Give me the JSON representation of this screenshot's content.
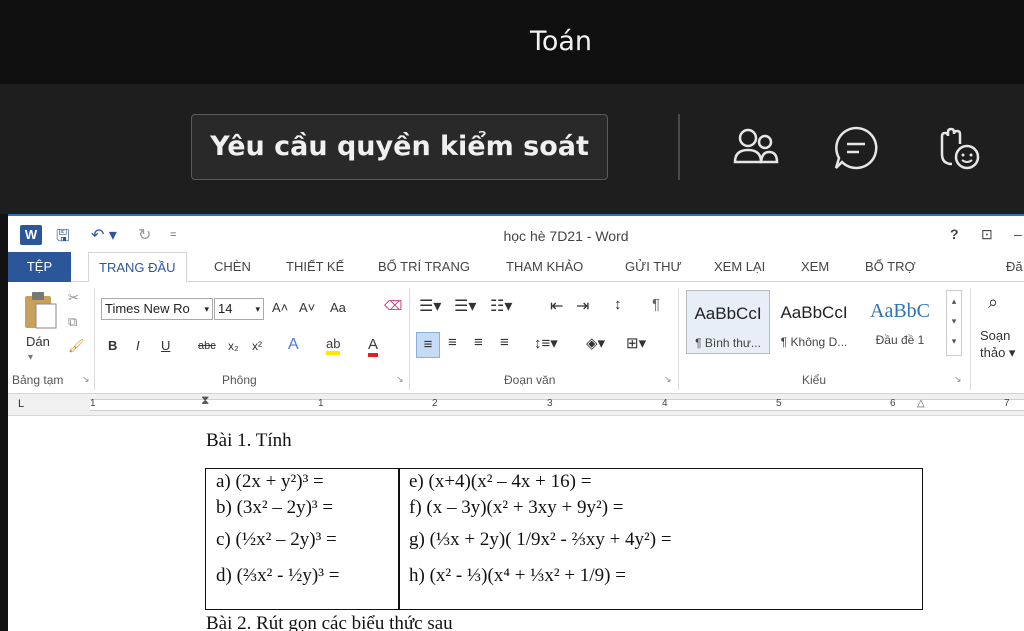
{
  "meeting": {
    "title": "Toán",
    "request_control_label": "Yêu cầu quyền kiểm soát",
    "icons": [
      "people-icon",
      "chat-icon",
      "raise-hand-icon"
    ]
  },
  "word": {
    "window_title": "học hè 7D21 - Word",
    "help_symbol": "?",
    "tabs": [
      "TỆP",
      "TRANG ĐẦU",
      "CHÈN",
      "THIẾT KẾ",
      "BỐ TRÍ TRANG",
      "THAM KHẢO",
      "GỬI THƯ",
      "XEM LẠI",
      "XEM",
      "BỔ TRỢ",
      "Đă"
    ],
    "clipboard": {
      "paste_label": "Dán",
      "group_label": "Bảng tạm"
    },
    "font": {
      "name": "Times New Ro",
      "size": "14",
      "group_label": "Phông",
      "bold": "B",
      "italic": "I",
      "underline": "U",
      "strike": "abc",
      "subscript": "x₂",
      "superscript": "x²",
      "grow": "A˄",
      "shrink": "A˅",
      "case": "Aa"
    },
    "paragraph": {
      "group_label": "Đoạn văn"
    },
    "styles": {
      "group_label": "Kiểu",
      "items": [
        {
          "sample": "AaBbCcI",
          "name": "¶ Bình thư..."
        },
        {
          "sample": "AaBbCcI",
          "name": "¶ Không D..."
        },
        {
          "sample": "AaBbC",
          "name": "Đầu đề 1"
        }
      ]
    },
    "editing": {
      "label": "Soạn",
      "label2": "thảo ▾"
    },
    "ruler_numbers": [
      "1",
      "1",
      "2",
      "3",
      "4",
      "5",
      "6",
      "7"
    ],
    "document": {
      "heading1": "Bài 1. Tính",
      "left_items": [
        "a) (2x + y²)³ =",
        "b) (3x² – 2y)³ =",
        "c) (½x² – 2y)³ =",
        "d) (⅔x² - ½y)³ ="
      ],
      "right_items": [
        "e) (x+4)(x² – 4x + 16) =",
        "f) (x – 3y)(x² + 3xy + 9y²) =",
        "g) (⅓x + 2y)( 1/9x² - ⅔xy + 4y²) =",
        "h) (x² - ⅓)(x⁴ + ⅓x² + 1/9) ="
      ],
      "heading2": "Bài 2. Rút gọn các biểu thức sau"
    }
  },
  "colors": {
    "word_blue": "#2b579a",
    "dark_bg": "#1e1e1e"
  }
}
